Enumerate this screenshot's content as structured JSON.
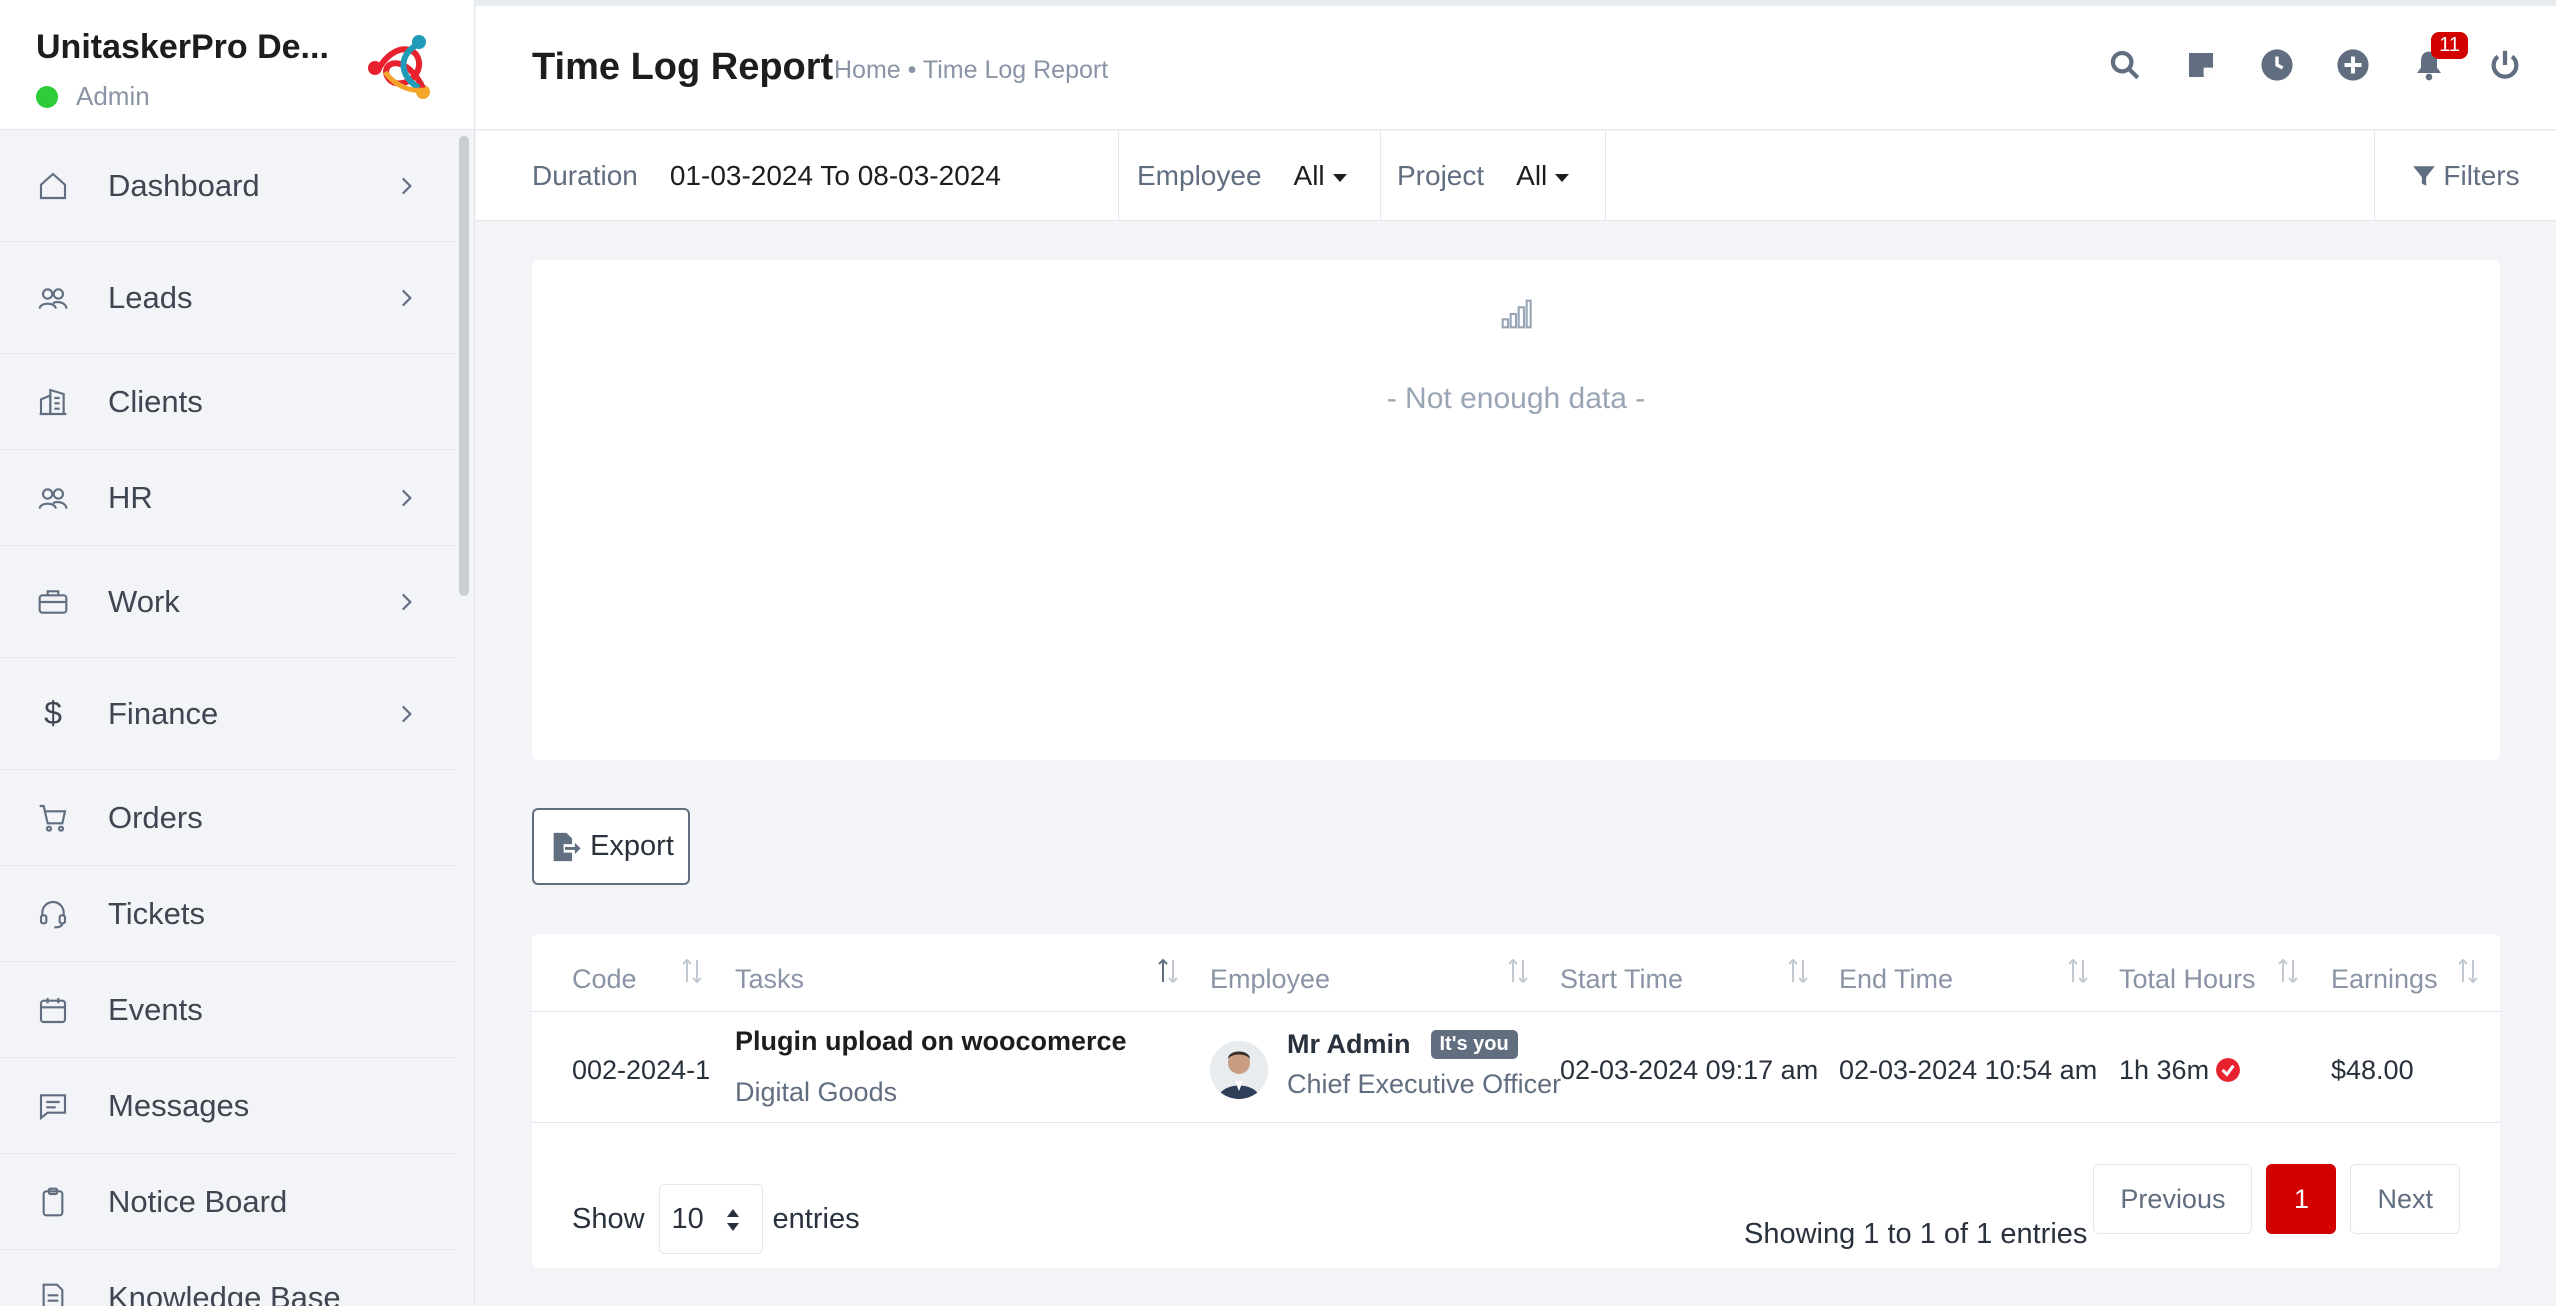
{
  "app": {
    "name": "UnitaskerPro De...",
    "role": "Admin"
  },
  "sidebar": {
    "items": [
      {
        "label": "Dashboard",
        "icon": "home-icon"
      },
      {
        "label": "Leads",
        "icon": "users-icon"
      },
      {
        "label": "Clients",
        "icon": "building-icon"
      },
      {
        "label": "HR",
        "icon": "users-icon"
      },
      {
        "label": "Work",
        "icon": "briefcase-icon"
      },
      {
        "label": "Finance",
        "icon": "dollar-icon"
      },
      {
        "label": "Orders",
        "icon": "cart-icon"
      },
      {
        "label": "Tickets",
        "icon": "headset-icon"
      },
      {
        "label": "Events",
        "icon": "calendar-icon"
      },
      {
        "label": "Messages",
        "icon": "message-icon"
      },
      {
        "label": "Notice Board",
        "icon": "clipboard-icon"
      },
      {
        "label": "Knowledge Base",
        "icon": "document-icon"
      }
    ]
  },
  "header": {
    "title": "Time Log Report",
    "breadcrumb": "Home • Time Log Report",
    "notification_count": "11"
  },
  "filters": {
    "duration_label": "Duration",
    "duration_value": "01-03-2024 To 08-03-2024",
    "employee_label": "Employee",
    "employee_value": "All",
    "project_label": "Project",
    "project_value": "All",
    "filters_label": "Filters"
  },
  "chart": {
    "empty_text": "- Not enough data -"
  },
  "export_label": "Export",
  "table": {
    "columns": [
      "Code",
      "Tasks",
      "Employee",
      "Start Time",
      "End Time",
      "Total Hours",
      "Earnings"
    ],
    "rows": [
      {
        "code": "002-2024-1",
        "task": "Plugin upload on woocomerce",
        "project": "Digital Goods",
        "employee_name": "Mr Admin",
        "employee_badge": "It's you",
        "employee_title": "Chief Executive Officer",
        "start_time": "02-03-2024 09:17 am",
        "end_time": "02-03-2024 10:54 am",
        "total_hours": "1h 36m",
        "earnings": "$48.00"
      }
    ],
    "show_label": "Show",
    "page_length": "10",
    "entries_label": "entries",
    "info": "Showing 1 to 1 of 1 entries",
    "prev_label": "Previous",
    "current_page": "1",
    "next_label": "Next"
  },
  "colors": {
    "accent": "#d30000",
    "online": "#2fcc3a",
    "approved": "#e8212f"
  }
}
